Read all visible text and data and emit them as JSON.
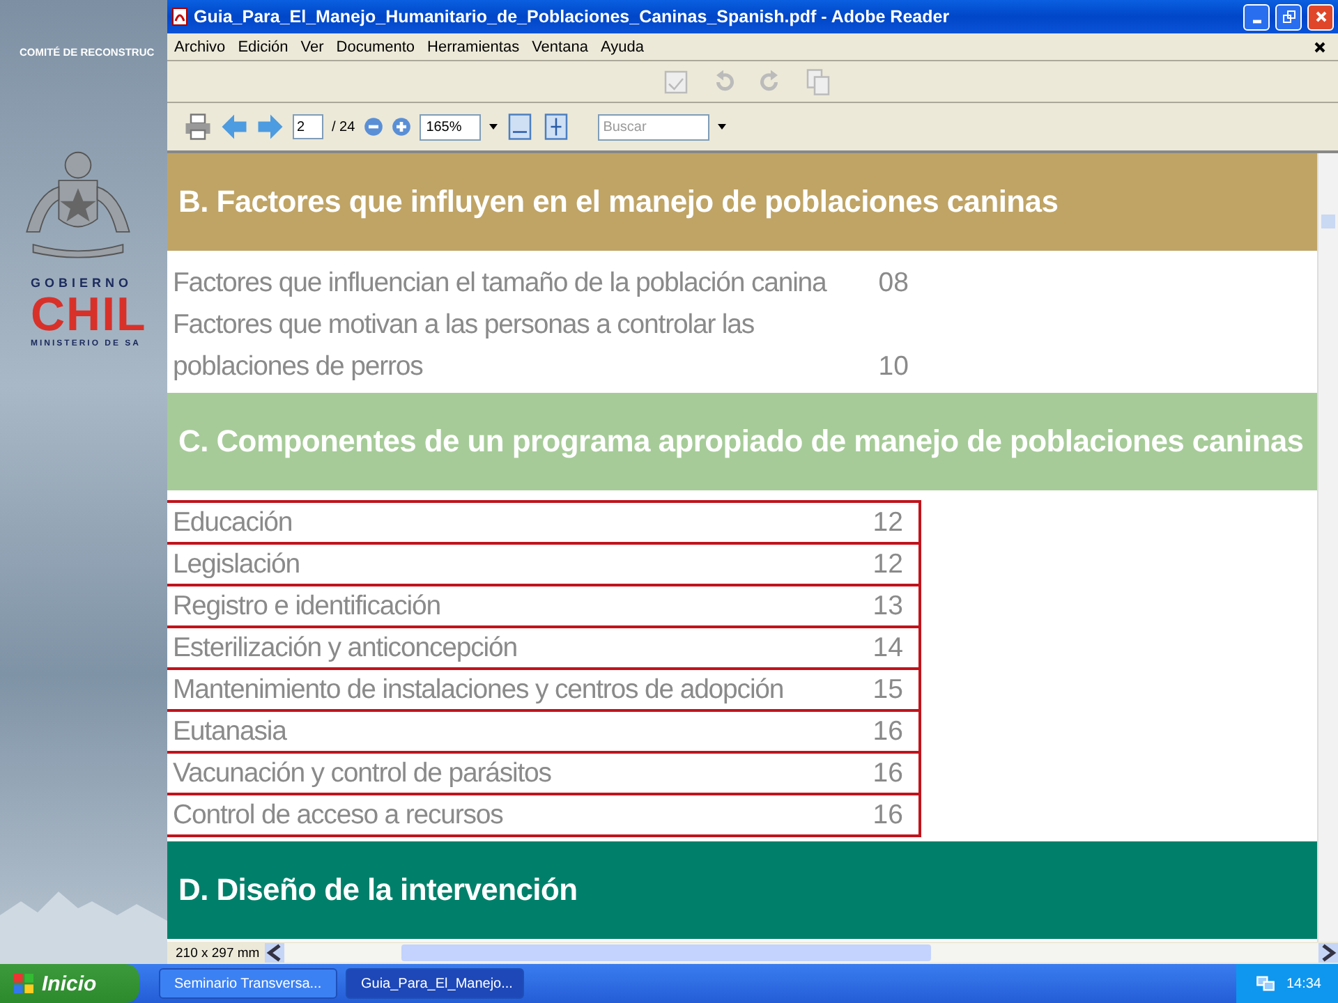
{
  "background": {
    "committee": "COMITÉ DE RECONSTRUC",
    "logo_top": "GOBIERNO",
    "logo_main": "CHIL",
    "logo_bottom": "MINISTERIO DE SA"
  },
  "window": {
    "title": "Guia_Para_El_Manejo_Humanitario_de_Poblaciones_Caninas_Spanish.pdf - Adobe Reader"
  },
  "menu": [
    "Archivo",
    "Edición",
    "Ver",
    "Documento",
    "Herramientas",
    "Ventana",
    "Ayuda"
  ],
  "toolbar": {
    "page": "2",
    "page_count": "/ 24",
    "zoom": "165%",
    "search_placeholder": "Buscar"
  },
  "sections": [
    {
      "title": "B. Factores que influyen en el manejo de poblaciones caninas",
      "color": "#bfa466",
      "items": [
        {
          "title": "Factores que influencian el tamaño de la población canina",
          "page": "08",
          "boxed": false
        },
        {
          "title": "Factores que motivan a las personas a controlar las\npoblaciones de perros",
          "page": "10",
          "boxed": false
        }
      ]
    },
    {
      "title": "C. Componentes de un programa apropiado de manejo de poblaciones caninas",
      "color": "#a6cb98",
      "items": [
        {
          "title": "Educación",
          "page": "12",
          "boxed": true
        },
        {
          "title": "Legislación",
          "page": "12",
          "boxed": true
        },
        {
          "title": "Registro e identificación",
          "page": "13",
          "boxed": true
        },
        {
          "title": "Esterilización y anticoncepción",
          "page": "14",
          "boxed": true
        },
        {
          "title": "Mantenimiento de instalaciones y centros de adopción",
          "page": "15",
          "boxed": true
        },
        {
          "title": "Eutanasia",
          "page": "16",
          "boxed": true
        },
        {
          "title": "Vacunación y control de parásitos",
          "page": "16",
          "boxed": true
        },
        {
          "title": "Control de acceso a recursos",
          "page": "16",
          "boxed": true
        }
      ]
    },
    {
      "title": "D. Diseño de la intervención",
      "color": "#00806a"
    }
  ],
  "page_size": "210 x 297 mm",
  "taskbar": {
    "start": "Inicio",
    "tasks": [
      {
        "label": "Seminario Transversa...",
        "selected": false
      },
      {
        "label": "Guia_Para_El_Manejo...",
        "selected": true
      }
    ],
    "clock": "14:34"
  }
}
